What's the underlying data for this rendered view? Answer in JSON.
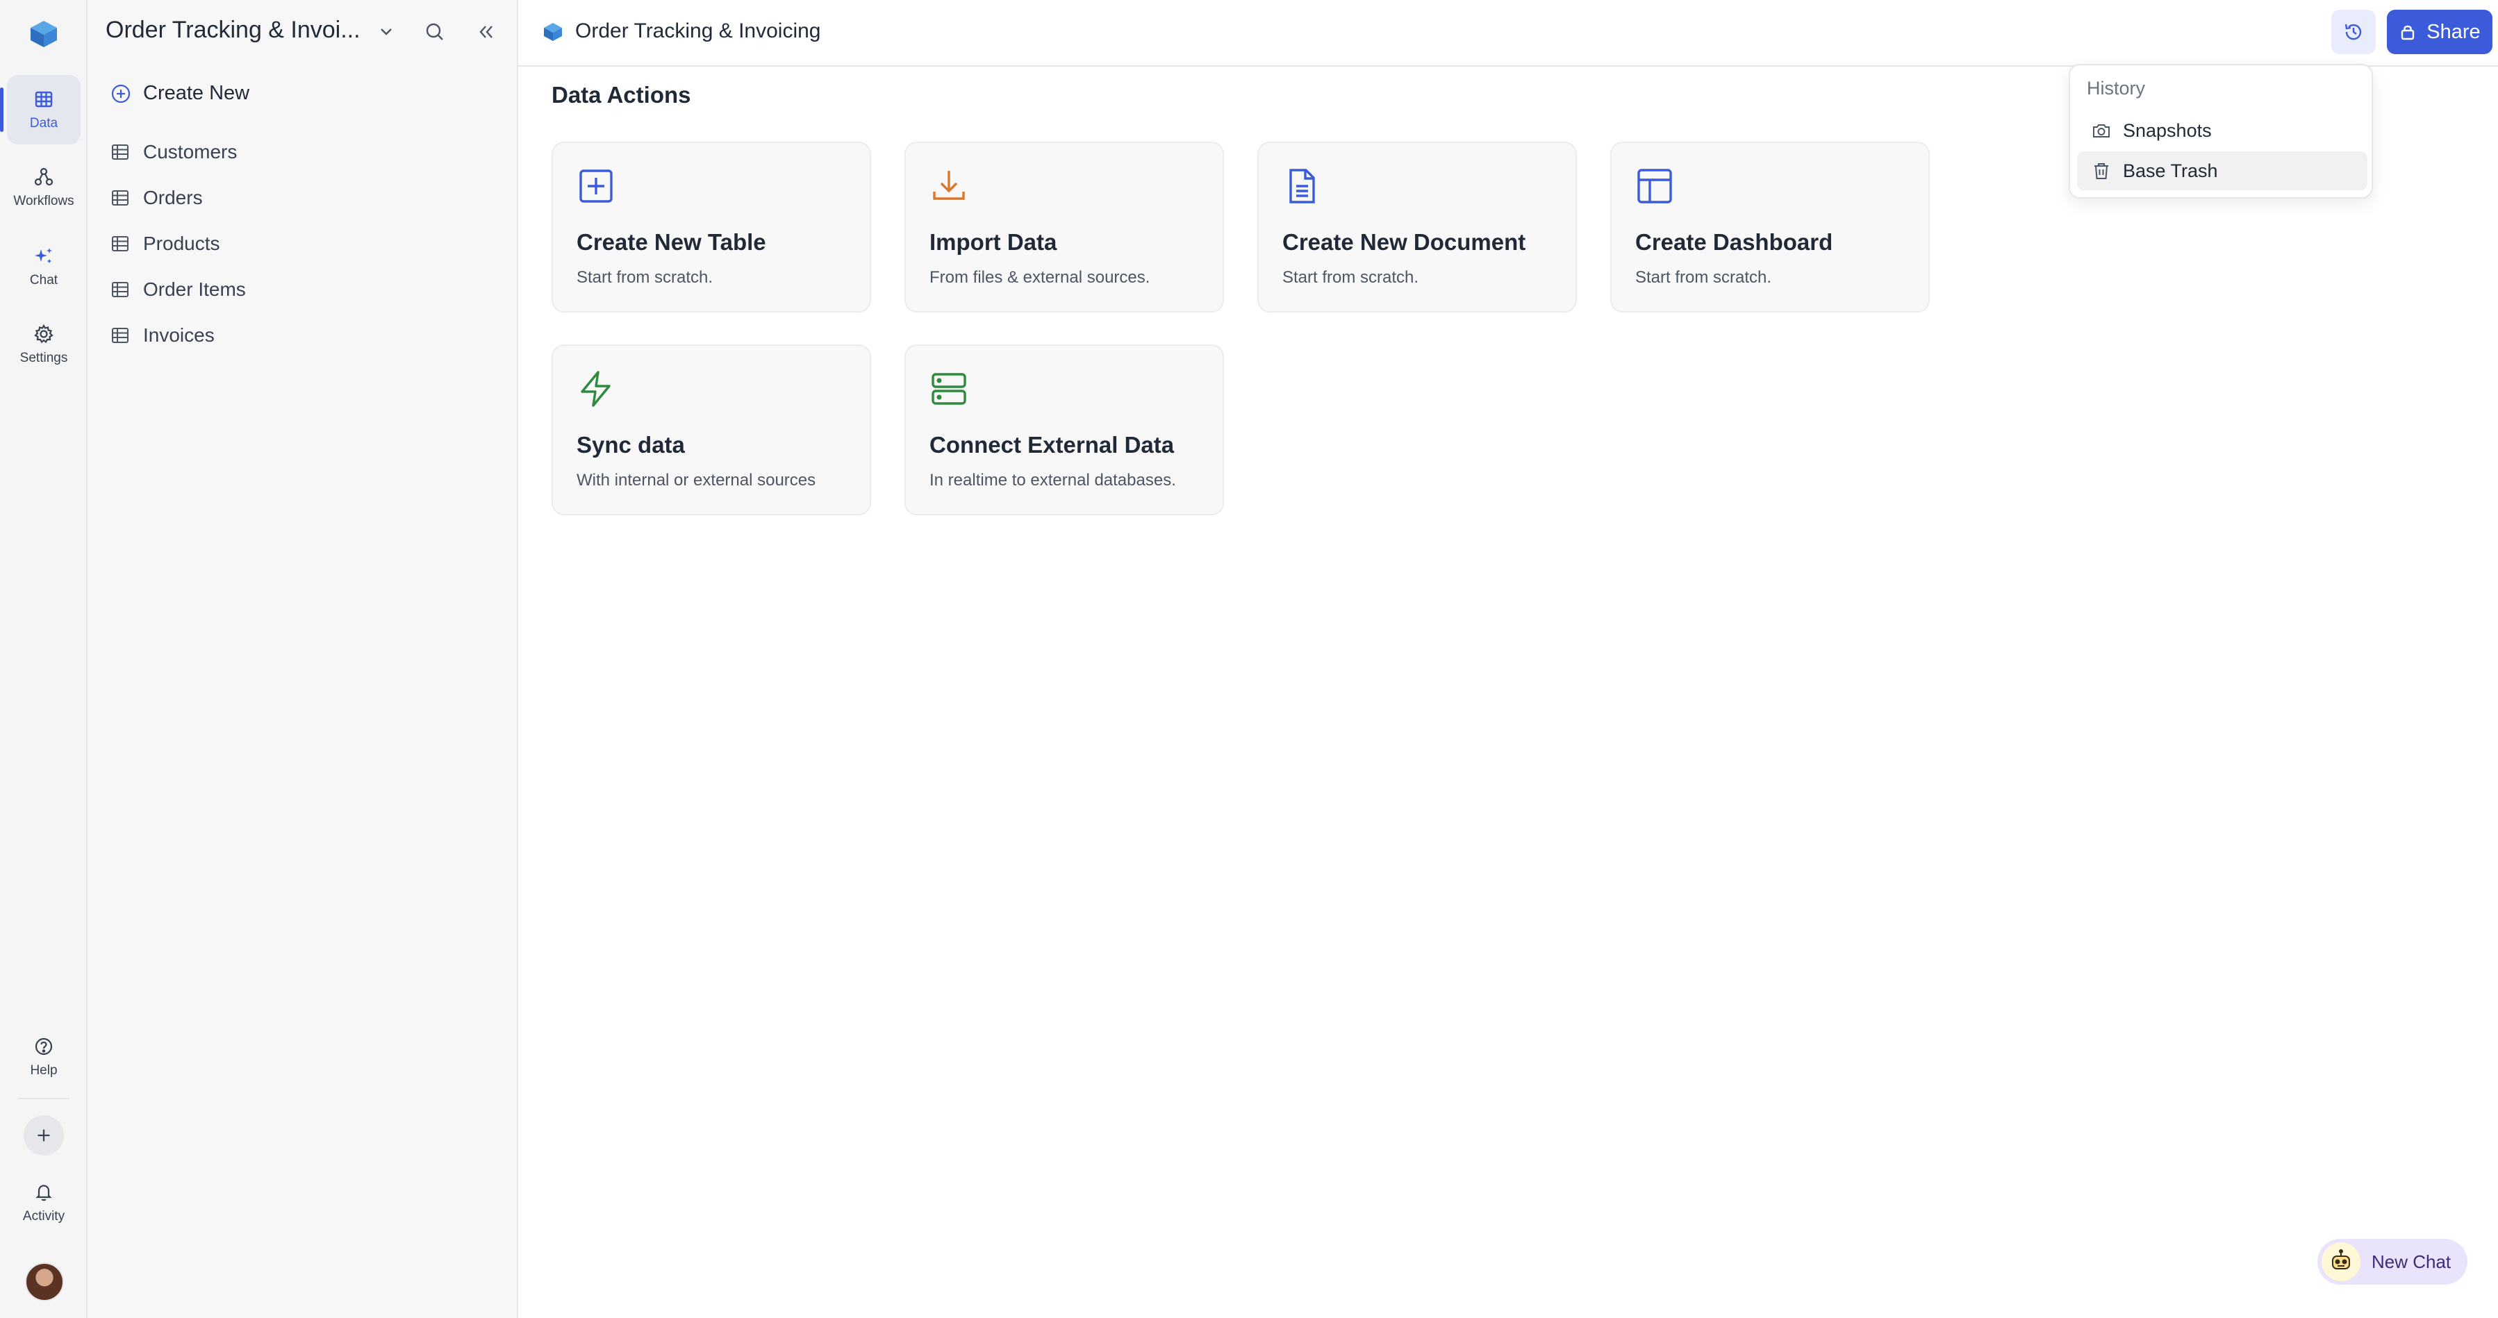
{
  "rail": {
    "items": [
      {
        "label": "Data"
      },
      {
        "label": "Workflows"
      },
      {
        "label": "Chat"
      },
      {
        "label": "Settings"
      }
    ],
    "bottom": [
      {
        "label": "Help"
      },
      {
        "label": "Activity"
      }
    ],
    "accent": "#3b5bdb"
  },
  "sidebar": {
    "title": "Order Tracking & Invoi...",
    "create_new": "Create New",
    "tables": [
      {
        "label": "Customers"
      },
      {
        "label": "Orders"
      },
      {
        "label": "Products"
      },
      {
        "label": "Order Items"
      },
      {
        "label": "Invoices"
      }
    ]
  },
  "topbar": {
    "title": "Order Tracking & Invoicing",
    "share_label": "Share"
  },
  "main": {
    "section_title": "Data Actions",
    "cards": [
      {
        "title": "Create New Table",
        "subtitle": "Start from scratch.",
        "icon": "plus-square-icon",
        "color": "#3b5bdb"
      },
      {
        "title": "Import Data",
        "subtitle": "From files & external sources.",
        "icon": "download-icon",
        "color": "#d9772b"
      },
      {
        "title": "Create New Document",
        "subtitle": "Start from scratch.",
        "icon": "document-icon",
        "color": "#3b5bdb"
      },
      {
        "title": "Create Dashboard",
        "subtitle": "Start from scratch.",
        "icon": "dashboard-icon",
        "color": "#3b5bdb"
      },
      {
        "title": "Sync data",
        "subtitle": "With internal or external sources",
        "icon": "lightning-icon",
        "color": "#2f8a3e"
      },
      {
        "title": "Connect External Data",
        "subtitle": "In realtime to external databases.",
        "icon": "server-icon",
        "color": "#2f8a3e"
      }
    ]
  },
  "history_menu": {
    "header": "History",
    "items": [
      {
        "label": "Snapshots",
        "icon": "camera-icon"
      },
      {
        "label": "Base Trash",
        "icon": "trash-icon"
      }
    ]
  },
  "chat": {
    "new_chat_label": "New Chat"
  }
}
